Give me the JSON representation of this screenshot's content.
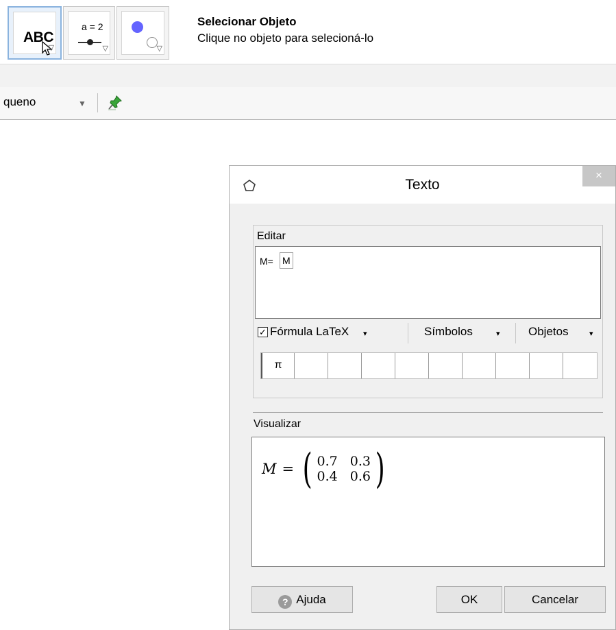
{
  "toolbar": {
    "tools": [
      {
        "name": "text-tool",
        "label": "ABC"
      },
      {
        "name": "slider-tool",
        "label": "a = 2"
      },
      {
        "name": "checkbox-tool",
        "label": ""
      }
    ],
    "current_tool_title": "Selecionar Objeto",
    "current_tool_help": "Clique no objeto para selecioná-lo"
  },
  "style_bar": {
    "size_value": "queno",
    "pin_icon": "pin-icon"
  },
  "dialog": {
    "title": "Texto",
    "close_label": "×",
    "edit": {
      "label": "Editar",
      "prefix": "M=",
      "object_ref": "M"
    },
    "options": {
      "latex_checked": true,
      "check_mark": "✓",
      "latex_label": "Fórmula LaTeX",
      "symbols_label": "Símbolos",
      "objects_label": "Objetos",
      "caret": "▾"
    },
    "symbol_strip": [
      "π",
      "",
      "",
      "",
      "",
      "",
      "",
      "",
      "",
      ""
    ],
    "preview": {
      "label": "Visualizar",
      "lhs": "M",
      "equals": "=",
      "matrix": [
        [
          "0.7",
          "0.3"
        ],
        [
          "0.4",
          "0.6"
        ]
      ]
    },
    "buttons": {
      "help": "Ajuda",
      "help_icon": "?",
      "ok": "OK",
      "cancel": "Cancelar"
    }
  },
  "colors": {
    "point_blue": "#6464ff",
    "active_tool_border": "#8ab3de",
    "close_button": "#c7c7c7"
  }
}
